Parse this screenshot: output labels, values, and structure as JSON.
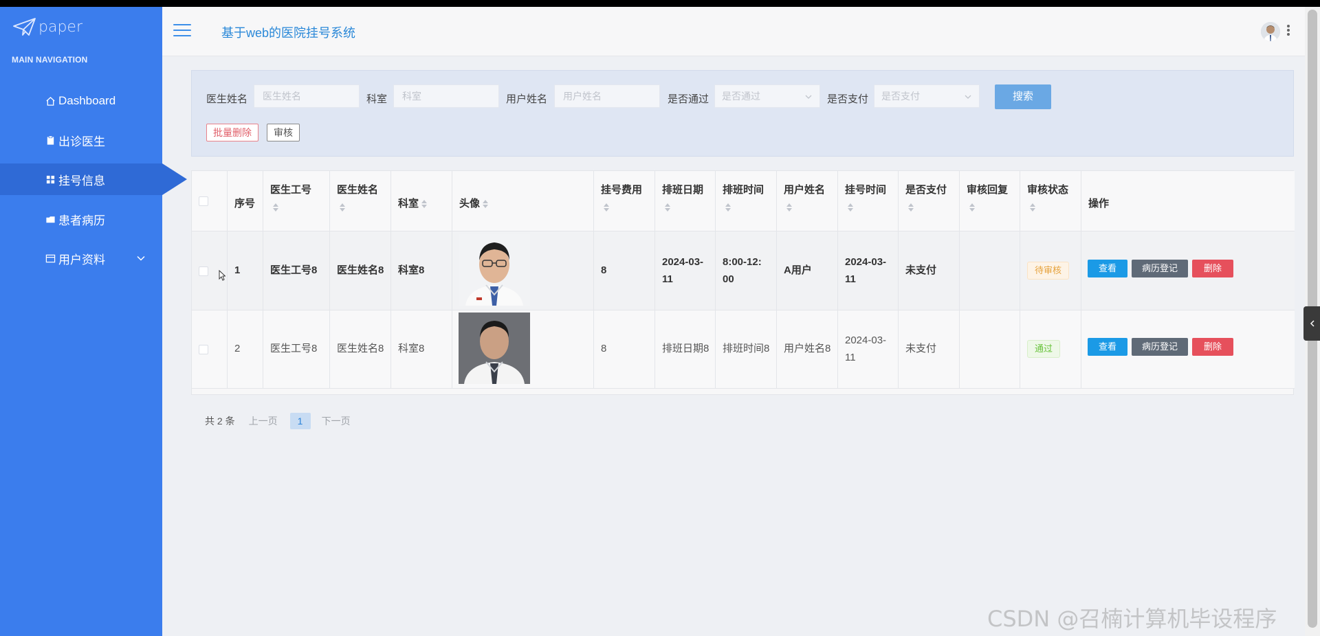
{
  "app": {
    "logo_text": "paper",
    "system_title": "基于web的医院挂号系统"
  },
  "sidebar": {
    "heading": "MAIN NAVIGATION",
    "items": [
      {
        "label": "Dashboard",
        "icon": "home-icon"
      },
      {
        "label": "出诊医生",
        "icon": "clipboard-icon"
      },
      {
        "label": "挂号信息",
        "icon": "grid-icon",
        "active": true
      },
      {
        "label": "患者病历",
        "icon": "folder-icon"
      },
      {
        "label": "用户资料",
        "icon": "card-icon",
        "expandable": true
      }
    ]
  },
  "search": {
    "fields": [
      {
        "label": "医生姓名",
        "placeholder": "医生姓名"
      },
      {
        "label": "科室",
        "placeholder": "科室"
      },
      {
        "label": "用户姓名",
        "placeholder": "用户姓名"
      }
    ],
    "selects": [
      {
        "label": "是否通过",
        "placeholder": "是否通过"
      },
      {
        "label": "是否支付",
        "placeholder": "是否支付"
      }
    ],
    "search_button": "搜索",
    "batch_delete_button": "批量删除",
    "audit_button": "审核"
  },
  "table": {
    "columns": [
      "序号",
      "医生工号",
      "医生姓名",
      "科室",
      "头像",
      "挂号费用",
      "排班日期",
      "排班时间",
      "用户姓名",
      "挂号时间",
      "是否支付",
      "审核回复",
      "审核状态",
      "操作"
    ],
    "rows": [
      {
        "index": "1",
        "doctor_no": "医生工号8",
        "doctor_name": "医生姓名8",
        "dept": "科室8",
        "fee": "8",
        "schedule_date_line1": "2024-03-",
        "schedule_date_line2": "11",
        "schedule_time_line1": "8:00-12:",
        "schedule_time_line2": "00",
        "user_name": "A用户",
        "reg_time_line1": "2024-03-",
        "reg_time_line2": "11",
        "paid": "未支付",
        "reply": "",
        "status": "待审核"
      },
      {
        "index": "2",
        "doctor_no": "医生工号8",
        "doctor_name": "医生姓名8",
        "dept": "科室8",
        "fee": "8",
        "schedule_date_line1": "排班日期8",
        "schedule_date_line2": "",
        "schedule_time_line1": "排班时间8",
        "schedule_time_line2": "",
        "user_name": "用户姓名8",
        "reg_time_line1": "2024-03-",
        "reg_time_line2": "11",
        "paid": "未支付",
        "reply": "",
        "status": "通过"
      }
    ],
    "actions": {
      "view": "查看",
      "record": "病历登记",
      "delete": "删除"
    }
  },
  "pagination": {
    "total": "共 2 条",
    "prev": "上一页",
    "current": "1",
    "next": "下一页"
  },
  "watermark": "CSDN @召楠计算机毕设程序",
  "colors": {
    "sidebar": "#3b7ded",
    "sidebar_active": "#2f6ad6",
    "title": "#2a88d8",
    "btn_view": "#1b9ae6",
    "btn_record": "#5f6a77",
    "btn_delete": "#e6505c"
  }
}
